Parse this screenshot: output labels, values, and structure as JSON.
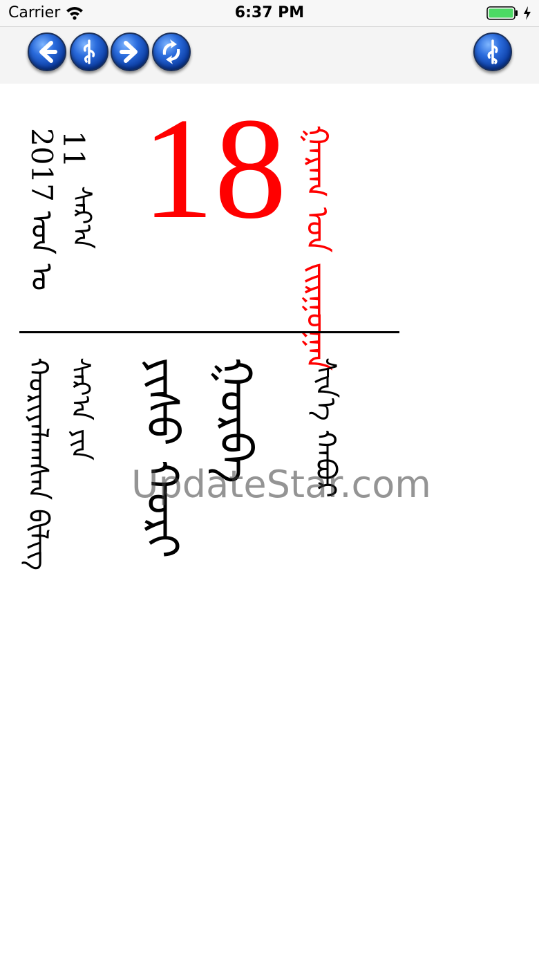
{
  "status_bar": {
    "carrier": "Carrier",
    "time": "6:37 PM",
    "battery_color": "#4cd964"
  },
  "toolbar": {
    "buttons": [
      {
        "name": "back",
        "icon": "arrow-left-icon"
      },
      {
        "name": "mongolian-script",
        "icon": "mongolian-script-icon"
      },
      {
        "name": "forward",
        "icon": "arrow-right-icon"
      },
      {
        "name": "refresh",
        "icon": "refresh-icon"
      },
      {
        "name": "mongolian-menu",
        "icon": "mongolian-script-icon"
      }
    ]
  },
  "calendar": {
    "month_number": "11",
    "month_word": "ᠰᠠᠷ᠎ᠠ",
    "year_line": "2017 ᠣᠨ ᠤ",
    "day": "18",
    "weekday": "ᠭᠠᠷᠠᠭ ᠤᠨ ᠵᠢᠷᠭᠤᠭᠠᠨ",
    "lunar_col1": "ᠬᠤᠷᠢᠶᠠᠯᠠᠭᠰᠠᠨ ᠪᠢᠯᠢᠭ",
    "lunar_col2": "ᠰᠠᠷ᠎ᠠ ᠶᠢᠨ",
    "lunar_col3": "ᠶᠢᠰᠦ ᠬᠤᠷᠢ",
    "lunar_col4": "ᠭᠤᠷᠪᠠ",
    "lunar_col5": "ᠰᠢᠨ᠎ᠡ ᠬᠠᠪᠤᠷ",
    "accent_color": "#ff0000"
  },
  "watermark": "UpdateStar.com"
}
